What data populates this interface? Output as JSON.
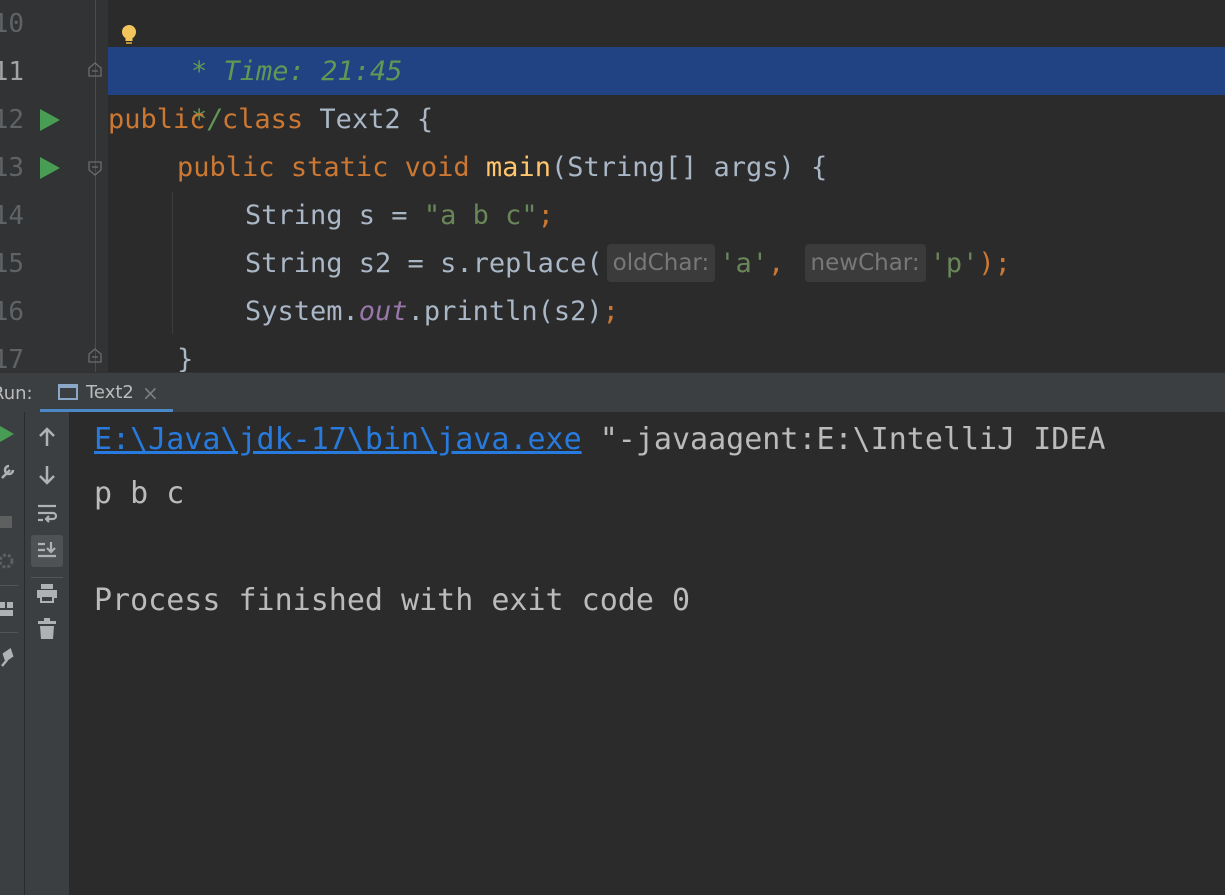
{
  "editor": {
    "line_numbers": [
      "10",
      "11",
      "12",
      "13",
      "14",
      "15",
      "16",
      "17"
    ],
    "lines": {
      "l10_comment": "* Time: 21:45",
      "l11_comment": "*/",
      "l12_public": "public",
      "l12_class": "class",
      "l12_rest": " Text2 {",
      "l13_public": "public",
      "l13_static": "static",
      "l13_void": "void",
      "l13_main": "main",
      "l13_rest": "(String[] args) {",
      "l14_a": "String s = ",
      "l14_str": "\"a b c\"",
      "l14_semi": ";",
      "l15_a": "String s2 = s.replace(",
      "l15_hint1": "oldChar:",
      "l15_str1": "'a'",
      "l15_comma": ",",
      "l15_hint2": "newChar:",
      "l15_str2": "'p'",
      "l15_end": ");",
      "l16_a": "System.",
      "l16_out": "out",
      "l16_b": ".println(s2)",
      "l16_semi": ";",
      "l17": "}"
    }
  },
  "run_panel": {
    "label": "Run:",
    "tab_label": "Text2",
    "tab_close": "×"
  },
  "console": {
    "cmd_link": "E:\\Java\\jdk-17\\bin\\java.exe",
    "cmd_rest": " \"-javaagent:E:\\IntelliJ IDEA",
    "output": "p b c",
    "finished": "Process finished with exit code 0"
  },
  "colors": {
    "background": "#2b2b2b",
    "selection": "#214283",
    "keyword": "#cc7832",
    "string": "#6a8759",
    "comment": "#629755",
    "link": "#287bde",
    "run_green": "#499c54"
  }
}
